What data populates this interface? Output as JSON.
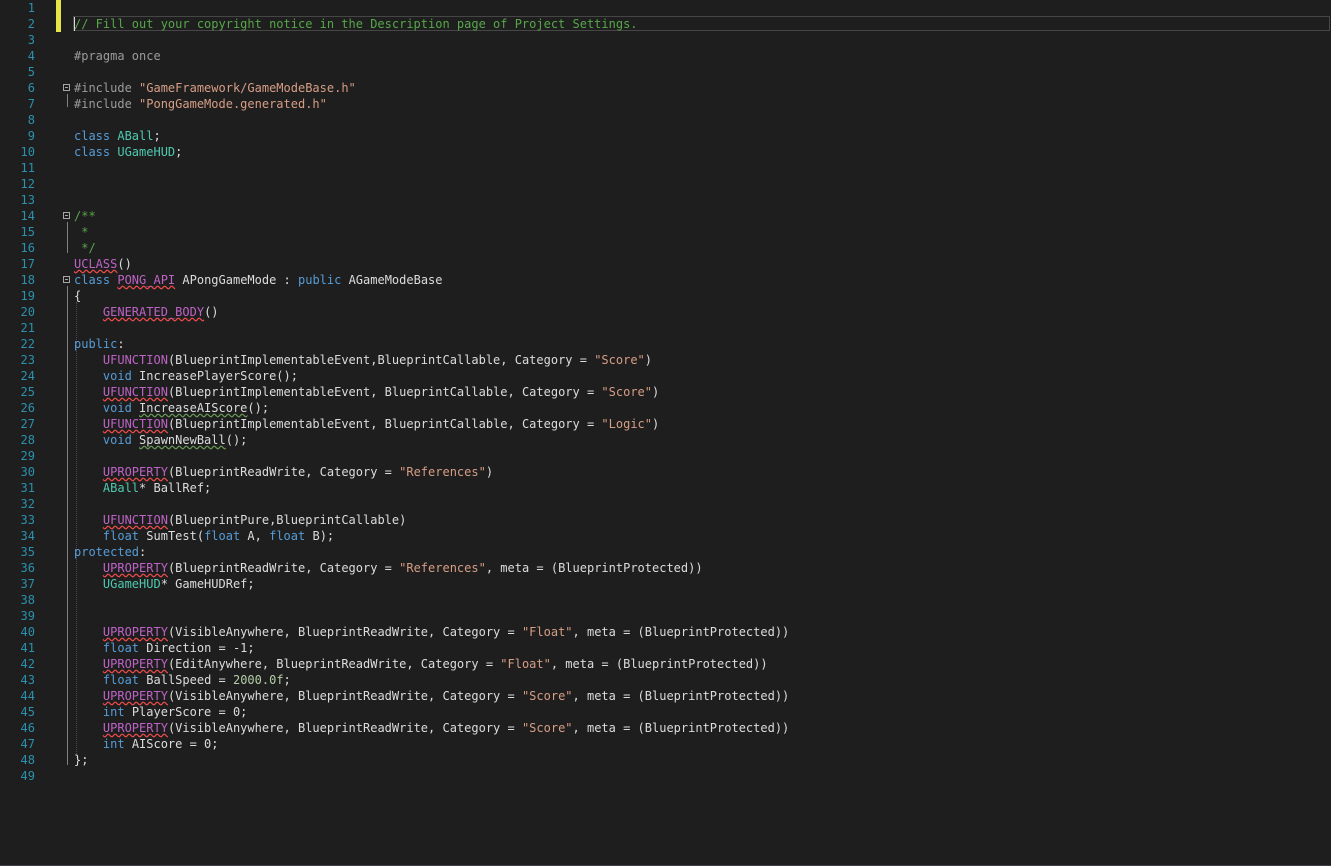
{
  "editor": {
    "colors": {
      "background": "#1e1e1e",
      "line_number": "#2b91af",
      "keyword": "#569cd6",
      "comment": "#57a64a",
      "string": "#d69d85",
      "type": "#4ec9b0",
      "macro": "#bd63c5",
      "number": "#b5cea8",
      "change_marker": "#e5e547"
    },
    "lines": [
      {
        "n": "1",
        "tokens": []
      },
      {
        "n": "2",
        "tokens": [
          {
            "t": "// Fill out your copyright notice in the Description page of Project Settings.",
            "c": "cm"
          }
        ]
      },
      {
        "n": "3",
        "tokens": []
      },
      {
        "n": "4",
        "tokens": [
          {
            "t": "#pragma once",
            "c": "pp"
          }
        ]
      },
      {
        "n": "5",
        "tokens": []
      },
      {
        "n": "6",
        "outline": true,
        "tokens": [
          {
            "t": "#include ",
            "c": "pp"
          },
          {
            "t": "\"GameFramework/GameModeBase.h\"",
            "c": "st"
          }
        ]
      },
      {
        "n": "7",
        "tokens": [
          {
            "t": "#include ",
            "c": "pp"
          },
          {
            "t": "\"PongGameMode.generated.h\"",
            "c": "st"
          }
        ]
      },
      {
        "n": "8",
        "tokens": []
      },
      {
        "n": "9",
        "tokens": [
          {
            "t": "class ",
            "c": "kw"
          },
          {
            "t": "ABall",
            "c": "tp"
          },
          {
            "t": ";",
            "c": "pl"
          }
        ]
      },
      {
        "n": "10",
        "tokens": [
          {
            "t": "class ",
            "c": "kw"
          },
          {
            "t": "UGameHUD",
            "c": "tp"
          },
          {
            "t": ";",
            "c": "pl"
          }
        ]
      },
      {
        "n": "11",
        "tokens": []
      },
      {
        "n": "12",
        "tokens": []
      },
      {
        "n": "13",
        "tokens": []
      },
      {
        "n": "14",
        "outline": true,
        "tokens": [
          {
            "t": "/**",
            "c": "cm"
          }
        ]
      },
      {
        "n": "15",
        "tokens": [
          {
            "t": " *",
            "c": "cm"
          }
        ]
      },
      {
        "n": "16",
        "tokens": [
          {
            "t": " */",
            "c": "cm"
          }
        ]
      },
      {
        "n": "17",
        "tokens": [
          {
            "t": "UCLASS",
            "c": "mac",
            "s": "r"
          },
          {
            "t": "()",
            "c": "pl"
          }
        ]
      },
      {
        "n": "18",
        "outline": true,
        "tokens": [
          {
            "t": "class ",
            "c": "kw"
          },
          {
            "t": "PONG_API",
            "c": "mac",
            "s": "r"
          },
          {
            "t": " ",
            "c": "pl"
          },
          {
            "t": "APongGameMode",
            "c": "pl"
          },
          {
            "t": " : ",
            "c": "pl"
          },
          {
            "t": "public ",
            "c": "kw"
          },
          {
            "t": "AGameModeBase",
            "c": "pl"
          }
        ]
      },
      {
        "n": "19",
        "tokens": [
          {
            "t": "{",
            "c": "pl"
          }
        ]
      },
      {
        "n": "20",
        "tokens": [
          {
            "t": "    ",
            "c": "pl"
          },
          {
            "t": "GENERATED_BODY",
            "c": "mac",
            "s": "r"
          },
          {
            "t": "()",
            "c": "pl"
          }
        ]
      },
      {
        "n": "21",
        "tokens": []
      },
      {
        "n": "22",
        "tokens": [
          {
            "t": "public",
            "c": "kw"
          },
          {
            "t": ":",
            "c": "pl"
          }
        ]
      },
      {
        "n": "23",
        "tokens": [
          {
            "t": "    ",
            "c": "pl"
          },
          {
            "t": "UFUNCTION",
            "c": "mac"
          },
          {
            "t": "(BlueprintImplementableEvent,BlueprintCallable, Category = ",
            "c": "pl"
          },
          {
            "t": "\"Score\"",
            "c": "st"
          },
          {
            "t": ")",
            "c": "pl"
          }
        ]
      },
      {
        "n": "24",
        "tokens": [
          {
            "t": "    ",
            "c": "pl"
          },
          {
            "t": "void ",
            "c": "kw"
          },
          {
            "t": "IncreasePlayerScore();",
            "c": "pl"
          }
        ]
      },
      {
        "n": "25",
        "tokens": [
          {
            "t": "    ",
            "c": "pl"
          },
          {
            "t": "UFUNCTION",
            "c": "mac",
            "s": "r"
          },
          {
            "t": "(BlueprintImplementableEvent, BlueprintCallable, Category = ",
            "c": "pl"
          },
          {
            "t": "\"Score\"",
            "c": "st"
          },
          {
            "t": ")",
            "c": "pl"
          }
        ]
      },
      {
        "n": "26",
        "tokens": [
          {
            "t": "    ",
            "c": "pl"
          },
          {
            "t": "void ",
            "c": "kw"
          },
          {
            "t": "IncreaseAIScore",
            "c": "pl",
            "s": "g"
          },
          {
            "t": "();",
            "c": "pl"
          }
        ]
      },
      {
        "n": "27",
        "tokens": [
          {
            "t": "    ",
            "c": "pl"
          },
          {
            "t": "UFUNCTION",
            "c": "mac",
            "s": "r"
          },
          {
            "t": "(BlueprintImplementableEvent, BlueprintCallable, Category = ",
            "c": "pl"
          },
          {
            "t": "\"Logic\"",
            "c": "st"
          },
          {
            "t": ")",
            "c": "pl"
          }
        ]
      },
      {
        "n": "28",
        "tokens": [
          {
            "t": "    ",
            "c": "pl"
          },
          {
            "t": "void ",
            "c": "kw"
          },
          {
            "t": "SpawnNewBall",
            "c": "pl",
            "s": "g"
          },
          {
            "t": "();",
            "c": "pl"
          }
        ]
      },
      {
        "n": "29",
        "tokens": []
      },
      {
        "n": "30",
        "tokens": [
          {
            "t": "    ",
            "c": "pl"
          },
          {
            "t": "UPROPERTY",
            "c": "mac",
            "s": "r"
          },
          {
            "t": "(BlueprintReadWrite, Category = ",
            "c": "pl"
          },
          {
            "t": "\"References\"",
            "c": "st"
          },
          {
            "t": ")",
            "c": "pl"
          }
        ]
      },
      {
        "n": "31",
        "tokens": [
          {
            "t": "    ",
            "c": "pl"
          },
          {
            "t": "ABall",
            "c": "tp"
          },
          {
            "t": "* BallRef;",
            "c": "pl"
          }
        ]
      },
      {
        "n": "32",
        "tokens": []
      },
      {
        "n": "33",
        "tokens": [
          {
            "t": "    ",
            "c": "pl"
          },
          {
            "t": "UFUNCTION",
            "c": "mac",
            "s": "r"
          },
          {
            "t": "(BlueprintPure,BlueprintCallable)",
            "c": "pl"
          }
        ]
      },
      {
        "n": "34",
        "tokens": [
          {
            "t": "    ",
            "c": "pl"
          },
          {
            "t": "float ",
            "c": "kw"
          },
          {
            "t": "SumTest(",
            "c": "pl"
          },
          {
            "t": "float ",
            "c": "kw"
          },
          {
            "t": "A, ",
            "c": "pl"
          },
          {
            "t": "float ",
            "c": "kw"
          },
          {
            "t": "B);",
            "c": "pl"
          }
        ]
      },
      {
        "n": "35",
        "tokens": [
          {
            "t": "protected",
            "c": "kw"
          },
          {
            "t": ":",
            "c": "pl"
          }
        ]
      },
      {
        "n": "36",
        "tokens": [
          {
            "t": "    ",
            "c": "pl"
          },
          {
            "t": "UPROPERTY",
            "c": "mac",
            "s": "r"
          },
          {
            "t": "(BlueprintReadWrite, Category = ",
            "c": "pl"
          },
          {
            "t": "\"References\"",
            "c": "st"
          },
          {
            "t": ", meta = (BlueprintProtected))",
            "c": "pl"
          }
        ]
      },
      {
        "n": "37",
        "tokens": [
          {
            "t": "    ",
            "c": "pl"
          },
          {
            "t": "UGameHUD",
            "c": "tp"
          },
          {
            "t": "* GameHUDRef;",
            "c": "pl"
          }
        ]
      },
      {
        "n": "38",
        "tokens": []
      },
      {
        "n": "39",
        "tokens": []
      },
      {
        "n": "40",
        "tokens": [
          {
            "t": "    ",
            "c": "pl"
          },
          {
            "t": "UPROPERTY",
            "c": "mac",
            "s": "r"
          },
          {
            "t": "(VisibleAnywhere, BlueprintReadWrite, Category = ",
            "c": "pl"
          },
          {
            "t": "\"Float\"",
            "c": "st"
          },
          {
            "t": ", meta = (BlueprintProtected))",
            "c": "pl"
          }
        ]
      },
      {
        "n": "41",
        "tokens": [
          {
            "t": "    ",
            "c": "pl"
          },
          {
            "t": "float ",
            "c": "kw"
          },
          {
            "t": "Direction = -1;",
            "c": "pl"
          }
        ]
      },
      {
        "n": "42",
        "tokens": [
          {
            "t": "    ",
            "c": "pl"
          },
          {
            "t": "UPROPERTY",
            "c": "mac",
            "s": "r"
          },
          {
            "t": "(EditAnywhere, BlueprintReadWrite, Category = ",
            "c": "pl"
          },
          {
            "t": "\"Float\"",
            "c": "st"
          },
          {
            "t": ", meta = (BlueprintProtected))",
            "c": "pl"
          }
        ]
      },
      {
        "n": "43",
        "tokens": [
          {
            "t": "    ",
            "c": "pl"
          },
          {
            "t": "float ",
            "c": "kw"
          },
          {
            "t": "BallSpeed = ",
            "c": "pl"
          },
          {
            "t": "2000.0f",
            "c": "nm"
          },
          {
            "t": ";",
            "c": "pl"
          }
        ]
      },
      {
        "n": "44",
        "tokens": [
          {
            "t": "    ",
            "c": "pl"
          },
          {
            "t": "UPROPERTY",
            "c": "mac",
            "s": "r"
          },
          {
            "t": "(VisibleAnywhere, BlueprintReadWrite, Category = ",
            "c": "pl"
          },
          {
            "t": "\"Score\"",
            "c": "st"
          },
          {
            "t": ", meta = (BlueprintProtected))",
            "c": "pl"
          }
        ]
      },
      {
        "n": "45",
        "tokens": [
          {
            "t": "    ",
            "c": "pl"
          },
          {
            "t": "int ",
            "c": "kw"
          },
          {
            "t": "PlayerScore = 0;",
            "c": "pl"
          }
        ]
      },
      {
        "n": "46",
        "tokens": [
          {
            "t": "    ",
            "c": "pl"
          },
          {
            "t": "UPROPERTY",
            "c": "mac",
            "s": "r"
          },
          {
            "t": "(VisibleAnywhere, BlueprintReadWrite, Category = ",
            "c": "pl"
          },
          {
            "t": "\"Score\"",
            "c": "st"
          },
          {
            "t": ", meta = (BlueprintProtected))",
            "c": "pl"
          }
        ]
      },
      {
        "n": "47",
        "tokens": [
          {
            "t": "    ",
            "c": "pl"
          },
          {
            "t": "int ",
            "c": "kw"
          },
          {
            "t": "AIScore = 0;",
            "c": "pl"
          }
        ]
      },
      {
        "n": "48",
        "tokens": [
          {
            "t": "};",
            "c": "pl"
          }
        ]
      },
      {
        "n": "49",
        "tokens": []
      }
    ]
  }
}
